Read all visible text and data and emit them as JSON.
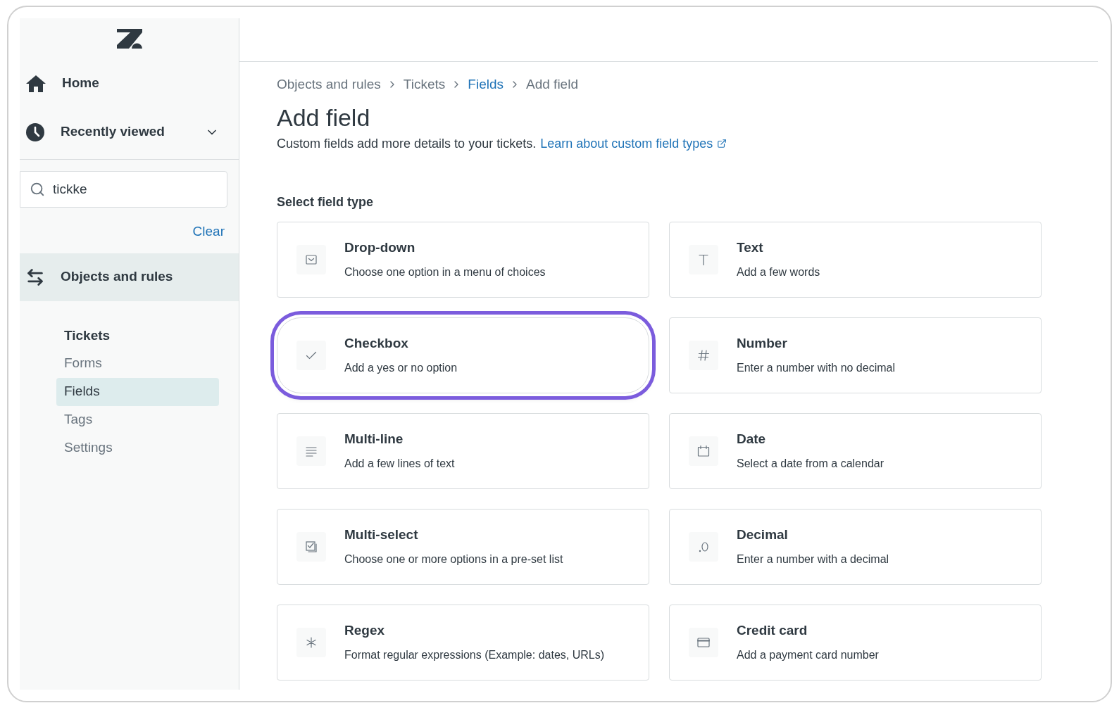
{
  "sidebar": {
    "nav": [
      {
        "kind": "home",
        "label": "Home",
        "selected": false
      },
      {
        "kind": "recent",
        "label": "Recently viewed",
        "selected": false,
        "expanded": false
      }
    ],
    "search": {
      "value": "tickke",
      "clear": "Clear"
    },
    "section": {
      "label": "Objects and rules",
      "selected": true,
      "group": "Tickets",
      "items": [
        {
          "label": "Forms",
          "selected": false
        },
        {
          "label": "Fields",
          "selected": true
        },
        {
          "label": "Tags",
          "selected": false
        },
        {
          "label": "Settings",
          "selected": false
        }
      ]
    }
  },
  "breadcrumbs": [
    {
      "label": "Objects and rules",
      "link": false
    },
    {
      "label": "Tickets",
      "link": false
    },
    {
      "label": "Fields",
      "link": true
    },
    {
      "label": "Add field",
      "link": false
    }
  ],
  "title": "Add field",
  "description": "Custom fields add more details to your tickets.",
  "learn_link": "Learn about custom field types",
  "section_label": "Select field type",
  "field_types": [
    {
      "kind": "dropdown",
      "name": "Drop-down",
      "desc": "Choose one option in a menu of choices",
      "highlighted": false
    },
    {
      "kind": "text",
      "name": "Text",
      "desc": "Add a few words",
      "highlighted": false
    },
    {
      "kind": "checkbox",
      "name": "Checkbox",
      "desc": "Add a yes or no option",
      "highlighted": true
    },
    {
      "kind": "number",
      "name": "Number",
      "desc": "Enter a number with no decimal",
      "highlighted": false
    },
    {
      "kind": "multiline",
      "name": "Multi-line",
      "desc": "Add a few lines of text",
      "highlighted": false
    },
    {
      "kind": "date",
      "name": "Date",
      "desc": "Select a date from a calendar",
      "highlighted": false
    },
    {
      "kind": "multiselect",
      "name": "Multi-select",
      "desc": "Choose one or more options in a pre-set list",
      "highlighted": false
    },
    {
      "kind": "decimal",
      "name": "Decimal",
      "desc": "Enter a number with a decimal",
      "highlighted": false
    },
    {
      "kind": "regex",
      "name": "Regex",
      "desc": "Format regular expressions (Example: dates, URLs)",
      "highlighted": false
    },
    {
      "kind": "creditcard",
      "name": "Credit card",
      "desc": "Add a payment card number",
      "highlighted": false
    }
  ]
}
